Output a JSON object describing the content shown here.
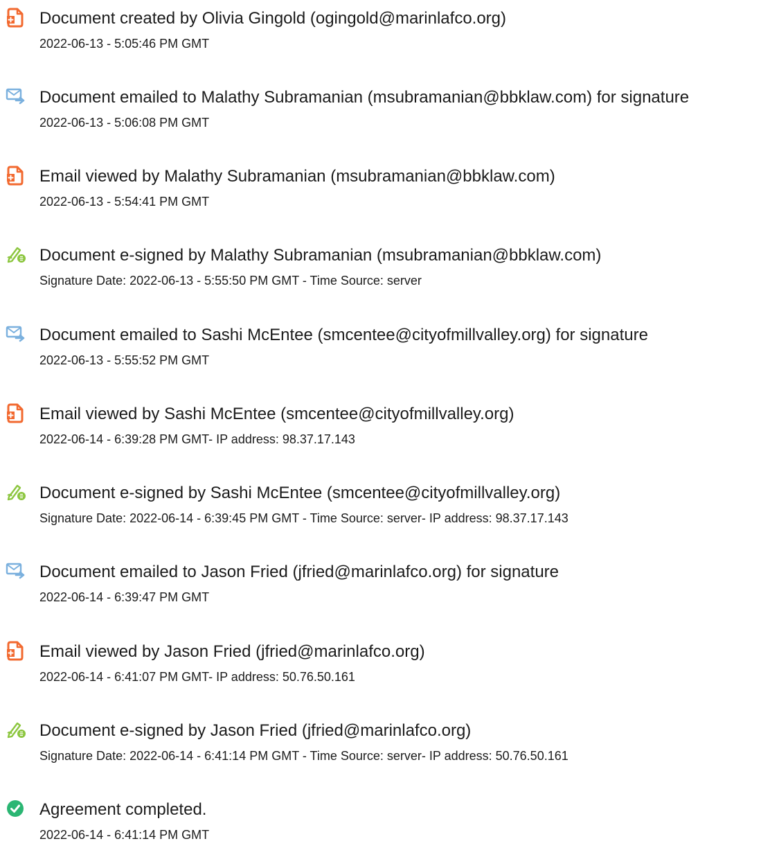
{
  "colors": {
    "doc_icon": "#f2692f",
    "mail_icon": "#7ab0de",
    "sign_icon": "#8cc63f",
    "check_icon": "#2bb673",
    "text": "#1b1b1b"
  },
  "events": [
    {
      "icon": "document-icon",
      "title": "Document created by Olivia Gingold (ogingold@marinlafco.org)",
      "detail": "2022-06-13 - 5:05:46 PM GMT"
    },
    {
      "icon": "email-sent-icon",
      "title": "Document emailed to Malathy Subramanian (msubramanian@bbklaw.com) for signature",
      "detail": "2022-06-13 - 5:06:08 PM GMT"
    },
    {
      "icon": "document-icon",
      "title": "Email viewed by Malathy Subramanian (msubramanian@bbklaw.com)",
      "detail": "2022-06-13 - 5:54:41 PM GMT"
    },
    {
      "icon": "esign-pen-icon",
      "title": "Document e-signed by Malathy Subramanian (msubramanian@bbklaw.com)",
      "detail": "Signature Date: 2022-06-13 - 5:55:50 PM GMT - Time Source: server"
    },
    {
      "icon": "email-sent-icon",
      "title": "Document emailed to Sashi McEntee (smcentee@cityofmillvalley.org) for signature",
      "detail": "2022-06-13 - 5:55:52 PM GMT"
    },
    {
      "icon": "document-icon",
      "title": "Email viewed by Sashi McEntee (smcentee@cityofmillvalley.org)",
      "detail": "2022-06-14 - 6:39:28 PM GMT- IP address: 98.37.17.143"
    },
    {
      "icon": "esign-pen-icon",
      "title": "Document e-signed by Sashi McEntee (smcentee@cityofmillvalley.org)",
      "detail": "Signature Date: 2022-06-14 - 6:39:45 PM GMT - Time Source: server- IP address: 98.37.17.143"
    },
    {
      "icon": "email-sent-icon",
      "title": "Document emailed to Jason Fried (jfried@marinlafco.org) for signature",
      "detail": "2022-06-14 - 6:39:47 PM GMT"
    },
    {
      "icon": "document-icon",
      "title": "Email viewed by Jason Fried (jfried@marinlafco.org)",
      "detail": "2022-06-14 - 6:41:07 PM GMT- IP address: 50.76.50.161"
    },
    {
      "icon": "esign-pen-icon",
      "title": "Document e-signed by Jason Fried (jfried@marinlafco.org)",
      "detail": "Signature Date: 2022-06-14 - 6:41:14 PM GMT - Time Source: server- IP address: 50.76.50.161"
    },
    {
      "icon": "check-circle-icon",
      "title": "Agreement completed.",
      "detail": "2022-06-14 - 6:41:14 PM GMT"
    }
  ]
}
